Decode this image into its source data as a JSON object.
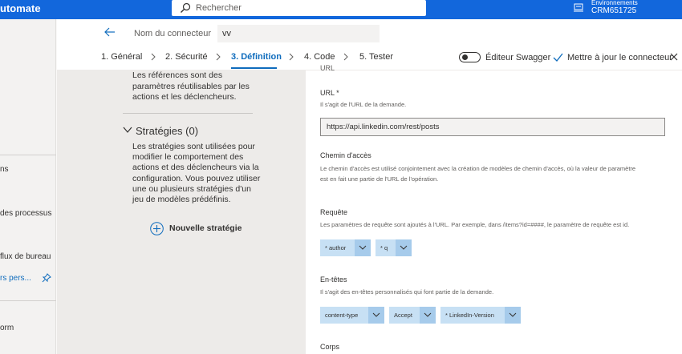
{
  "app": {
    "brand": "utomate"
  },
  "search": {
    "placeholder": "Rechercher"
  },
  "environment": {
    "label": "Environnements",
    "value": "CRM651725"
  },
  "leftnav": {
    "items": [
      {
        "label": "ns"
      },
      {
        "label": "des processus"
      },
      {
        "label": "flux de bureau"
      },
      {
        "label": "rs pers..."
      },
      {
        "label": "orm"
      }
    ]
  },
  "connector": {
    "name_label": "Nom du connecteur",
    "name_value": "vv"
  },
  "steps": [
    {
      "label": "1. Général"
    },
    {
      "label": "2. Sécurité"
    },
    {
      "label": "3. Définition"
    },
    {
      "label": "4. Code"
    },
    {
      "label": "5. Tester"
    }
  ],
  "toolbar": {
    "swagger_label": "Éditeur Swagger",
    "update_label": "Mettre à jour le connecteur"
  },
  "left_panel": {
    "references_text": "Les références sont des paramètres réutilisables par les actions et les déclencheurs.",
    "policies_title": "Stratégies (0)",
    "policies_text": "Les stratégies sont utilisées pour modifier le comportement des actions et des déclencheurs via la configuration. Vous pouvez utiliser une ou plusieurs stratégies d'un jeu de modèles prédéfinis.",
    "new_policy_label": "Nouvelle stratégie"
  },
  "request": {
    "top_cut": "URL",
    "url_label": "URL *",
    "url_desc": "Il s'agit de l'URL de la demande.",
    "url_value": "https://api.linkedin.com/rest/posts",
    "path_label": "Chemin d'accès",
    "path_desc_1": "Le chemin d'accès est utilisé conjointement avec la création de modèles de chemin d'accès, où la valeur de paramètre",
    "path_desc_2": "est en fait une partie de l'URL de l'opération.",
    "query_label": "Requête",
    "query_desc": "Les paramètres de requête sont ajoutés à l'URL. Par exemple, dans /items?id=####, le paramètre de requête est id.",
    "query_params": [
      "* author",
      "* q"
    ],
    "headers_label": "En-têtes",
    "headers_desc": "Il s'agit des en-têtes personnalisés qui font partie de la demande.",
    "headers": [
      "content-type",
      "Accept",
      "* LinkedIn-Version"
    ],
    "body_label": "Corps"
  },
  "colors": {
    "topbar": "#1267dc",
    "accent": "#0f6cbd",
    "chip": "#c7e0f4",
    "chip_drop": "#a6cbeb"
  }
}
